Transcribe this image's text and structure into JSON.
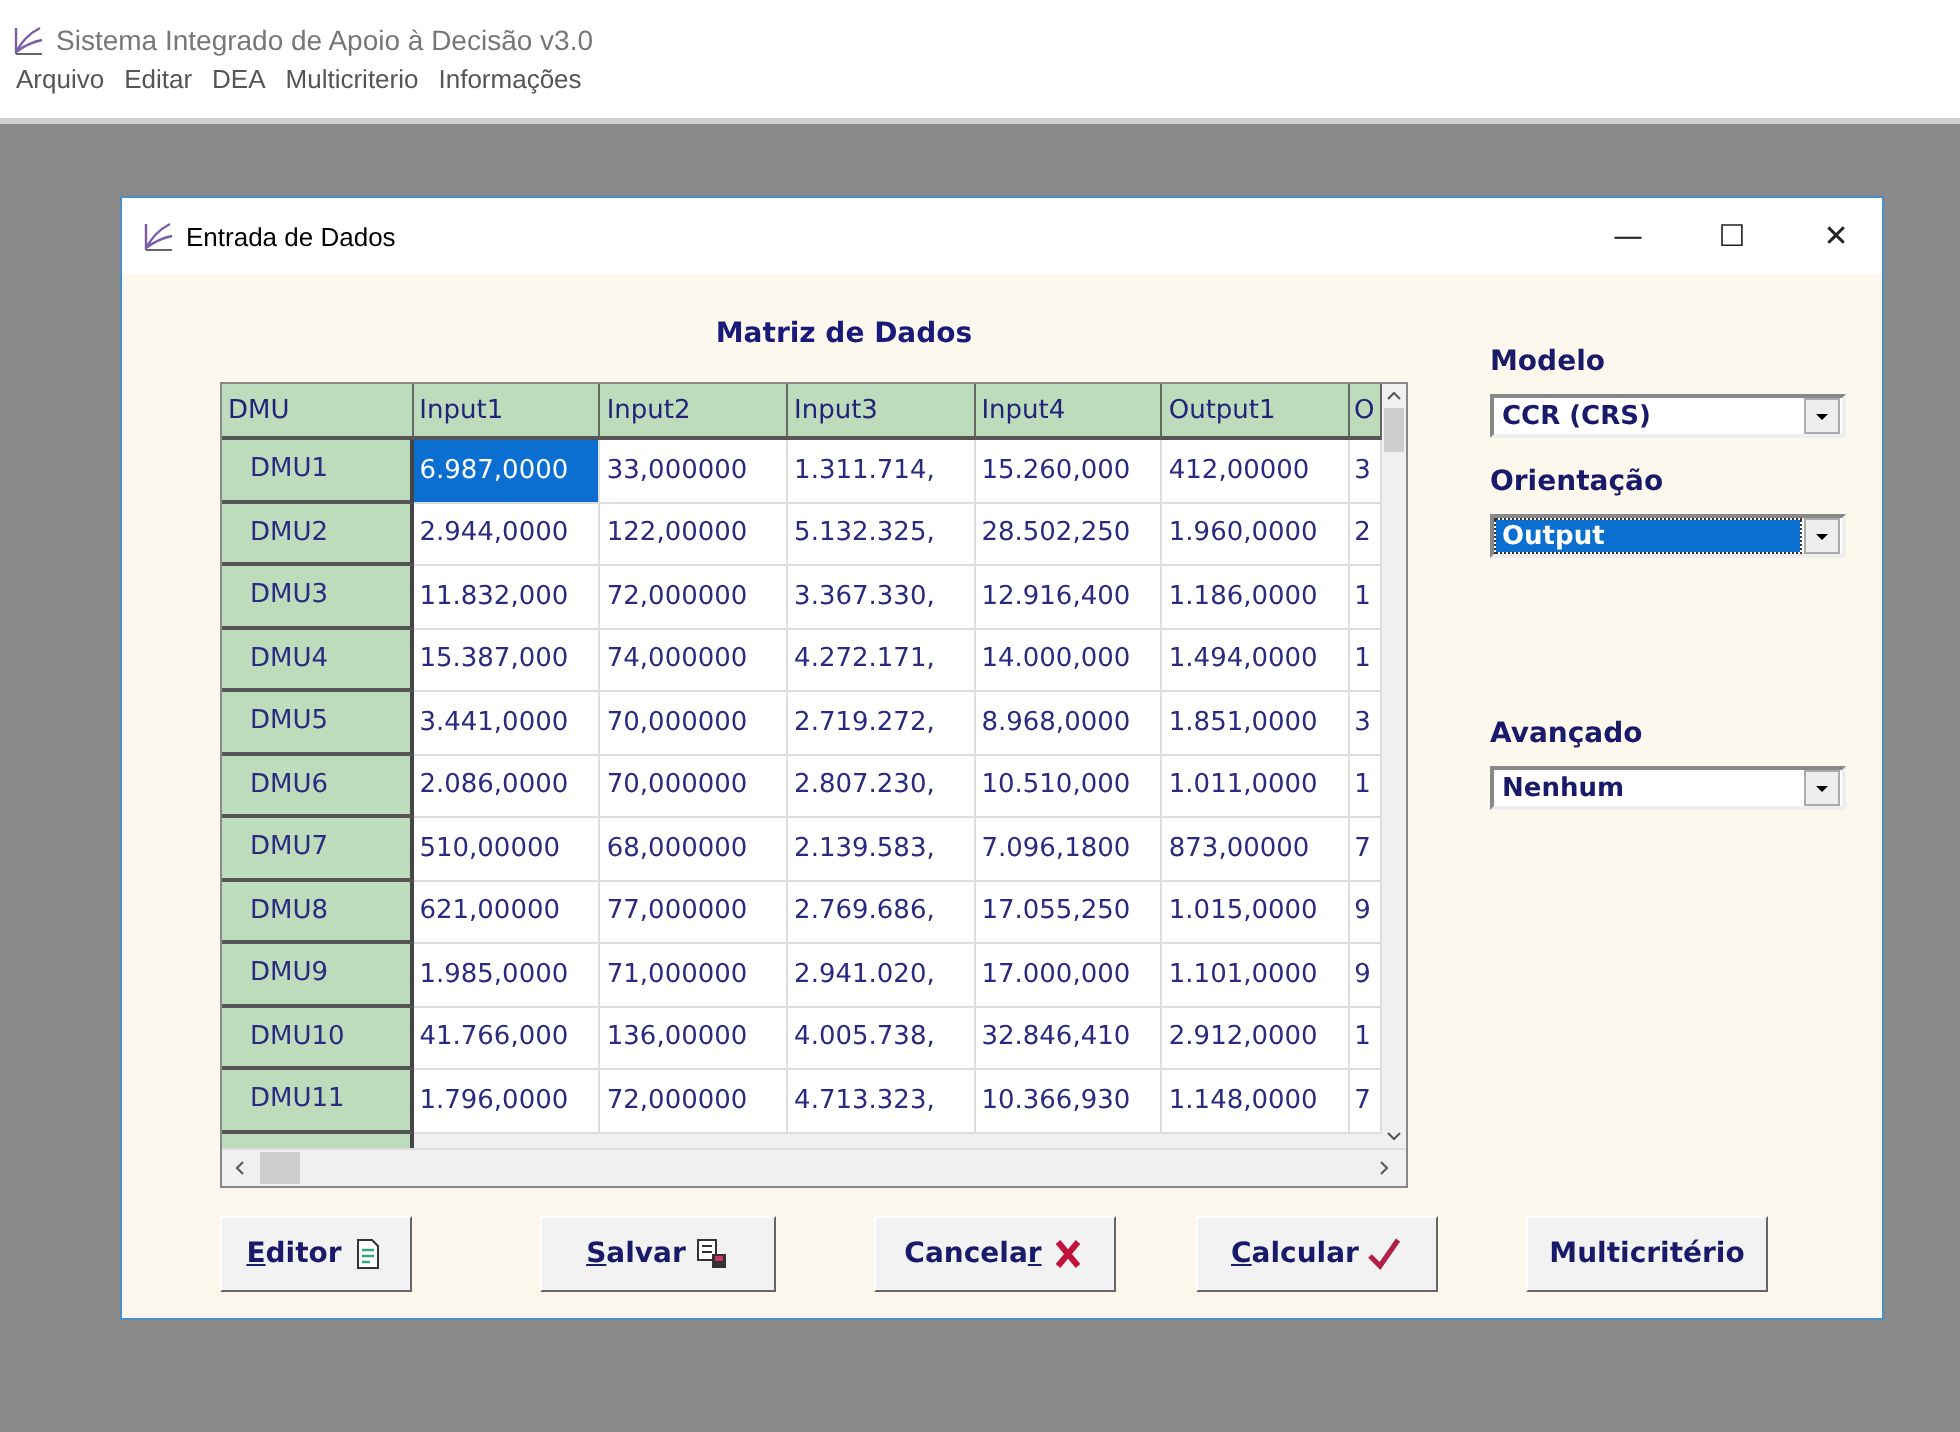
{
  "app": {
    "title": "Sistema Integrado de Apoio à Decisão v3.0"
  },
  "menu": [
    "Arquivo",
    "Editar",
    "DEA",
    "Multicriterio",
    "Informações"
  ],
  "dialog": {
    "title": "Entrada de Dados",
    "controls": [
      "—",
      "☐",
      "✕"
    ]
  },
  "table": {
    "title": "Matriz de Dados",
    "corner": "DMU",
    "columns": [
      "Input1",
      "Input2",
      "Input3",
      "Input4",
      "Output1",
      "O"
    ],
    "rows": [
      {
        "dmu": "DMU1",
        "cells": [
          {
            "v": "6.987,0000",
            "selected": true
          },
          {
            "v": "33,000000",
            "selected": false
          },
          {
            "v": "1.311.714,",
            "selected": false
          },
          {
            "v": "15.260,000",
            "selected": false
          },
          {
            "v": "412,00000",
            "selected": false
          },
          {
            "v": "3",
            "selected": false
          }
        ]
      },
      {
        "dmu": "DMU2",
        "cells": [
          {
            "v": "2.944,0000",
            "selected": false
          },
          {
            "v": "122,00000",
            "selected": false
          },
          {
            "v": "5.132.325,",
            "selected": false
          },
          {
            "v": "28.502,250",
            "selected": false
          },
          {
            "v": "1.960,0000",
            "selected": false
          },
          {
            "v": "2",
            "selected": false
          }
        ]
      },
      {
        "dmu": "DMU3",
        "cells": [
          {
            "v": "11.832,000",
            "selected": false
          },
          {
            "v": "72,000000",
            "selected": false
          },
          {
            "v": "3.367.330,",
            "selected": false
          },
          {
            "v": "12.916,400",
            "selected": false
          },
          {
            "v": "1.186,0000",
            "selected": false
          },
          {
            "v": "1",
            "selected": false
          }
        ]
      },
      {
        "dmu": "DMU4",
        "cells": [
          {
            "v": "15.387,000",
            "selected": false
          },
          {
            "v": "74,000000",
            "selected": false
          },
          {
            "v": "4.272.171,",
            "selected": false
          },
          {
            "v": "14.000,000",
            "selected": false
          },
          {
            "v": "1.494,0000",
            "selected": false
          },
          {
            "v": "1",
            "selected": false
          }
        ]
      },
      {
        "dmu": "DMU5",
        "cells": [
          {
            "v": "3.441,0000",
            "selected": false
          },
          {
            "v": "70,000000",
            "selected": false
          },
          {
            "v": "2.719.272,",
            "selected": false
          },
          {
            "v": "8.968,0000",
            "selected": false
          },
          {
            "v": "1.851,0000",
            "selected": false
          },
          {
            "v": "3",
            "selected": false
          }
        ]
      },
      {
        "dmu": "DMU6",
        "cells": [
          {
            "v": "2.086,0000",
            "selected": false
          },
          {
            "v": "70,000000",
            "selected": false
          },
          {
            "v": "2.807.230,",
            "selected": false
          },
          {
            "v": "10.510,000",
            "selected": false
          },
          {
            "v": "1.011,0000",
            "selected": false
          },
          {
            "v": "1",
            "selected": false
          }
        ]
      },
      {
        "dmu": "DMU7",
        "cells": [
          {
            "v": "510,00000",
            "selected": false
          },
          {
            "v": "68,000000",
            "selected": false
          },
          {
            "v": "2.139.583,",
            "selected": false
          },
          {
            "v": "7.096,1800",
            "selected": false
          },
          {
            "v": "873,00000",
            "selected": false
          },
          {
            "v": "7",
            "selected": false
          }
        ]
      },
      {
        "dmu": "DMU8",
        "cells": [
          {
            "v": "621,00000",
            "selected": false
          },
          {
            "v": "77,000000",
            "selected": false
          },
          {
            "v": "2.769.686,",
            "selected": false
          },
          {
            "v": "17.055,250",
            "selected": false
          },
          {
            "v": "1.015,0000",
            "selected": false
          },
          {
            "v": "9",
            "selected": false
          }
        ]
      },
      {
        "dmu": "DMU9",
        "cells": [
          {
            "v": "1.985,0000",
            "selected": false
          },
          {
            "v": "71,000000",
            "selected": false
          },
          {
            "v": "2.941.020,",
            "selected": false
          },
          {
            "v": "17.000,000",
            "selected": false
          },
          {
            "v": "1.101,0000",
            "selected": false
          },
          {
            "v": "9",
            "selected": false
          }
        ]
      },
      {
        "dmu": "DMU10",
        "cells": [
          {
            "v": "41.766,000",
            "selected": false
          },
          {
            "v": "136,00000",
            "selected": false
          },
          {
            "v": "4.005.738,",
            "selected": false
          },
          {
            "v": "32.846,410",
            "selected": false
          },
          {
            "v": "2.912,0000",
            "selected": false
          },
          {
            "v": "1",
            "selected": false
          }
        ]
      },
      {
        "dmu": "DMU11",
        "cells": [
          {
            "v": "1.796,0000",
            "selected": false
          },
          {
            "v": "72,000000",
            "selected": false
          },
          {
            "v": "4.713.323,",
            "selected": false
          },
          {
            "v": "10.366,930",
            "selected": false
          },
          {
            "v": "1.148,0000",
            "selected": false
          },
          {
            "v": "7",
            "selected": false
          }
        ]
      }
    ]
  },
  "options": [
    {
      "label": "Modelo",
      "value": "CCR (CRS)",
      "focused": false
    },
    {
      "label": "Orientação",
      "value": "Output",
      "focused": true
    },
    {
      "label": "Avançado",
      "value": "Nenhum",
      "focused": false
    }
  ],
  "buttons": [
    {
      "key": "E",
      "after": "ditor"
    },
    {
      "key": "S",
      "after": "alvar"
    },
    {
      "before": "Cancela",
      "key": "r"
    },
    {
      "key": "C",
      "after": "alcular"
    },
    {
      "before": "Multicritério"
    }
  ]
}
